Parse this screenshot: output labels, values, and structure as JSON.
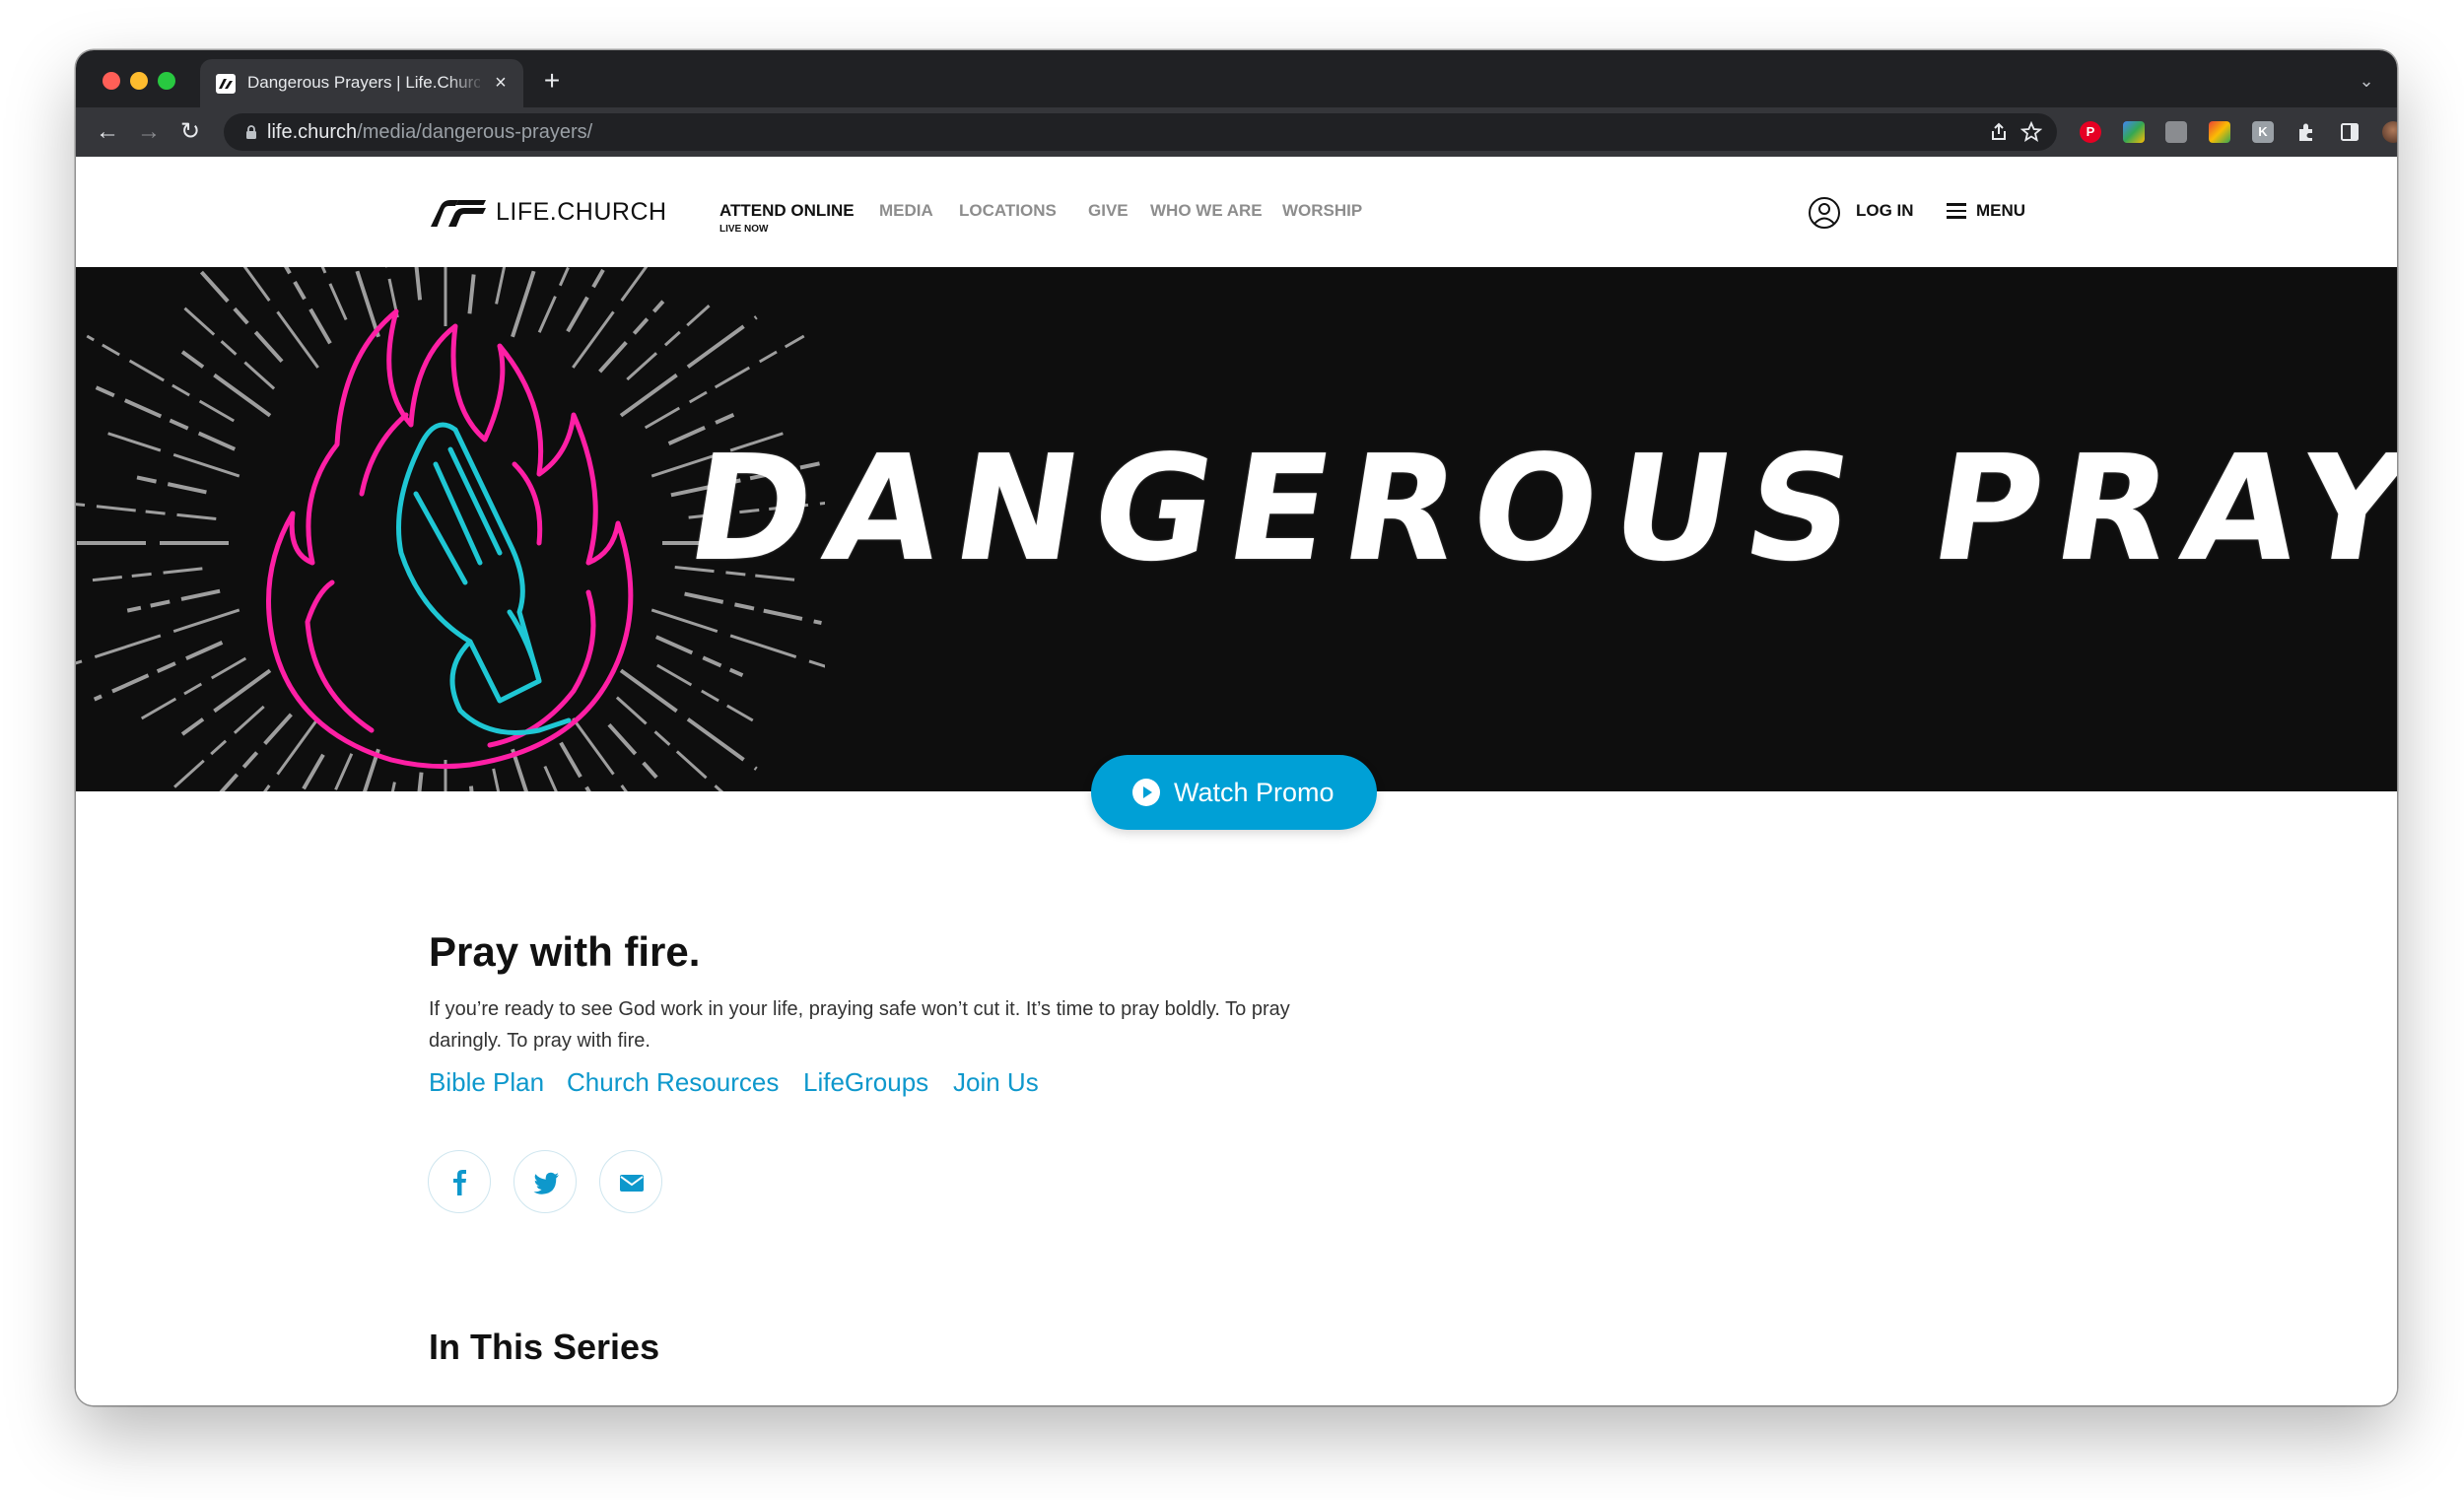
{
  "browser": {
    "tab_title": "Dangerous Prayers | Life.Church",
    "tab_close": "×",
    "new_tab": "+",
    "tab_menu": "⌄",
    "url_host": "life.church",
    "url_path": "/media/dangerous-prayers/",
    "back": "←",
    "forward": "→",
    "reload": "↻",
    "share_icon": "share-icon",
    "star_icon": "star-icon",
    "more": "⋮",
    "extensions": [
      {
        "name": "pinterest-extension-icon",
        "color": "#e60023"
      },
      {
        "name": "colorful-extension-icon",
        "color": "#34a853"
      },
      {
        "name": "grey-extension-icon",
        "color": "#8a8c90"
      },
      {
        "name": "palette-extension-icon",
        "color": "#fbbc04"
      },
      {
        "name": "k-extension-icon",
        "color": "#9aa0a6"
      }
    ]
  },
  "site": {
    "logo_text": "LIFE.CHURCH",
    "nav": [
      {
        "label": "ATTEND ONLINE",
        "active": true
      },
      {
        "label": "MEDIA"
      },
      {
        "label": "LOCATIONS"
      },
      {
        "label": "GIVE"
      },
      {
        "label": "WHO WE ARE"
      },
      {
        "label": "WORSHIP"
      }
    ],
    "nav_sub": "LIVE NOW",
    "login": "LOG IN",
    "menu": "MENU"
  },
  "hero": {
    "title": "DANGEROUS PRAYERS",
    "watch_label": "Watch Promo",
    "colors": {
      "flame": "#ff1fa5",
      "hands": "#1fc7d4",
      "background": "#0e0e0e",
      "button": "#00a0d6"
    }
  },
  "content": {
    "title": "Pray with fire.",
    "description": "If you’re ready to see God work in your life, praying safe won’t cut it. It’s time to pray boldly. To pray daringly. To pray with fire.",
    "links": [
      "Bible Plan",
      "Church Resources",
      "LifeGroups",
      "Join Us"
    ],
    "share": [
      "facebook-icon",
      "twitter-icon",
      "email-icon"
    ],
    "series_title": "In This Series"
  }
}
